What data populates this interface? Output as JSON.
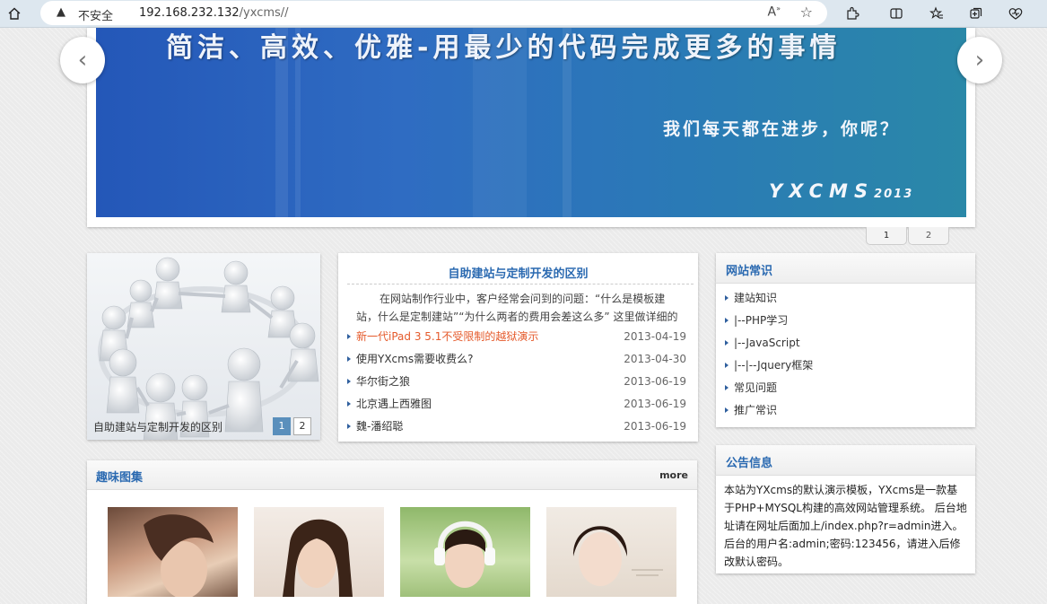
{
  "browser": {
    "not_secure_label": "不安全",
    "url_host": "192.168.232.132",
    "url_path": "/yxcms//"
  },
  "banner": {
    "headline": "简洁、高效、优雅-用最少的代码完成更多的事情",
    "slogan": "我们每天都在进步，你呢？",
    "brand": "YXCMS",
    "brand_year": "2013",
    "pages": [
      "1",
      "2"
    ]
  },
  "photo_slider": {
    "caption": "自助建站与定制开发的区别",
    "pages": [
      "1",
      "2"
    ]
  },
  "news": {
    "title": "自助建站与定制开发的区别",
    "description": "在网站制作行业中，客户经常会问到的问题：“什么是模板建站，什么是定制建站”“为什么两者的费用会差这么多” 这里做详细的说明",
    "items": [
      {
        "title": "新一代iPad 3 5.1不受限制的越狱演示",
        "date": "2013-04-19"
      },
      {
        "title": "使用YXcms需要收费么?",
        "date": "2013-04-30"
      },
      {
        "title": "华尔街之狼",
        "date": "2013-06-19"
      },
      {
        "title": "北京遇上西雅图",
        "date": "2013-06-19"
      },
      {
        "title": "魏-潘绍聪",
        "date": "2013-06-19"
      }
    ]
  },
  "sidebar": {
    "knowledge_title": "网站常识",
    "knowledge_items": [
      "建站知识",
      "|--PHP学习",
      "|--JavaScript",
      "|--|--Jquery框架",
      "常见问题",
      "推广常识"
    ],
    "notice_title": "公告信息",
    "notice_text": "本站为YXcms的默认演示模板，YXcms是一款基于PHP+MYSQL构建的高效网站管理系统。 后台地址请在网址后面加上/index.php?r=admin进入。 后台的用户名:admin;密码:123456，请进入后修改默认密码。"
  },
  "gallery": {
    "title": "趣味图集",
    "more": "more"
  },
  "colors": {
    "link_blue": "#2b6ab1",
    "hot_orange": "#e55a2b",
    "banner_blue": "#2f6cc2"
  }
}
